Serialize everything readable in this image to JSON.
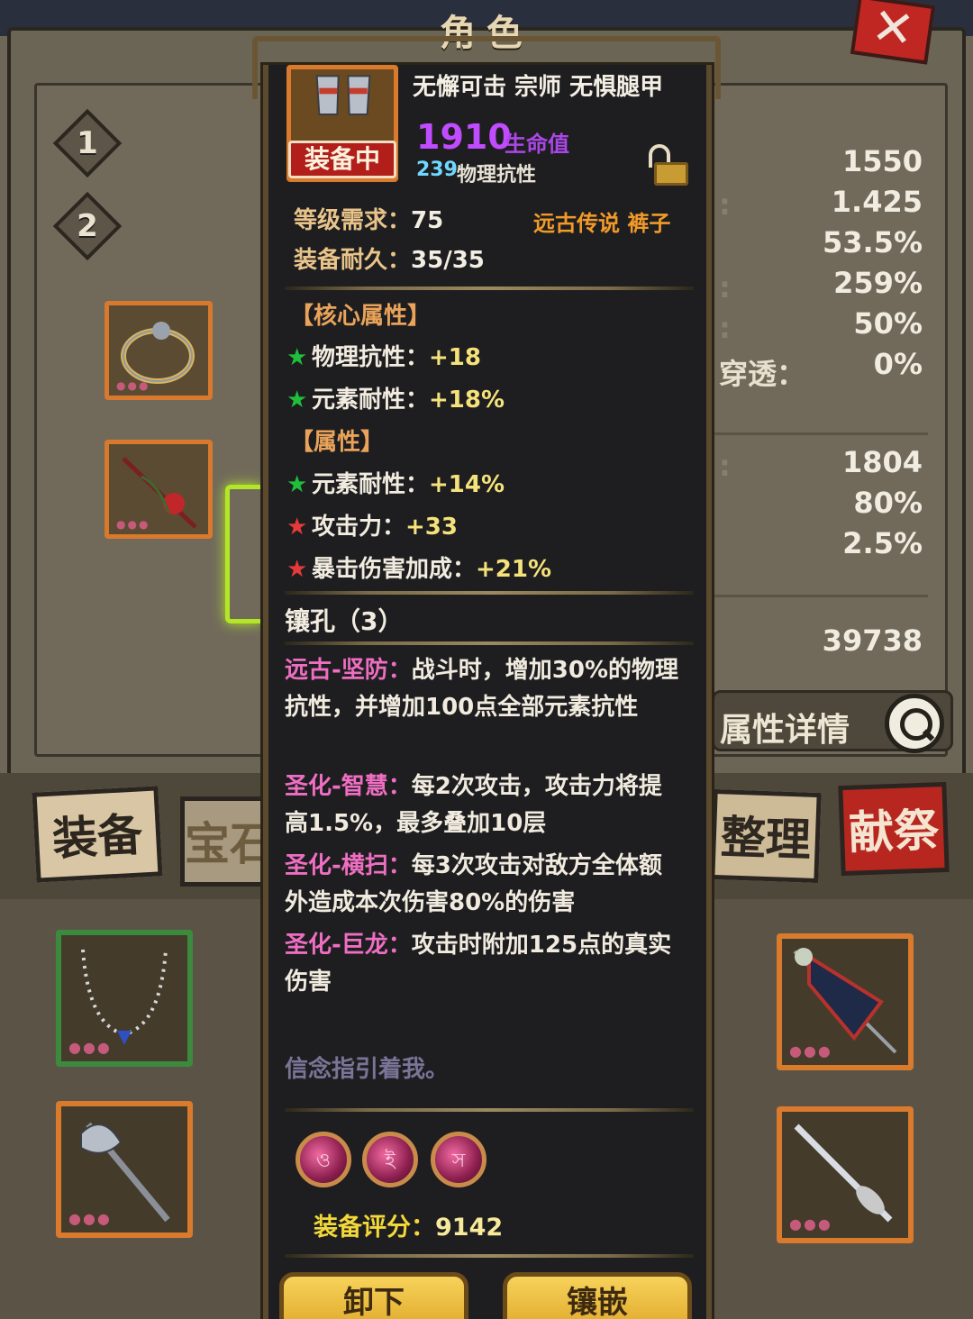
{
  "screen": {
    "title": "角色"
  },
  "left_panel": {
    "slot_tabs": [
      "1",
      "2"
    ]
  },
  "stats_panel": {
    "values": [
      "1550",
      "1.425",
      "53.5%",
      "259%",
      "50%",
      "0%",
      "1804",
      "80%",
      "2.5%",
      "39738"
    ],
    "visible_partial_label": "穿透：",
    "details_label": "属性详情"
  },
  "tabs": {
    "equip": "装备",
    "gem": "宝石",
    "sort": "整理",
    "sacrifice": "献祭"
  },
  "tooltip": {
    "item_name": "无懈可击 宗师 无惧腿甲",
    "equipped_badge": "装备中",
    "hp_value": "1910",
    "hp_label": "生命值",
    "phys_res_value": "239",
    "phys_res_label": "物理抗性",
    "level_req_label": "等级需求：",
    "level_req_value": "75",
    "durability_label": "装备耐久：",
    "durability_value": "35/35",
    "rarity": "远古传说 裤子",
    "core_header": "【核心属性】",
    "core_attrs": [
      {
        "star": "green",
        "name": "物理抗性：",
        "value": "+18"
      },
      {
        "star": "green",
        "name": "元素耐性：",
        "value": "+18%"
      }
    ],
    "attr_header": "【属性】",
    "attrs": [
      {
        "star": "green",
        "name": "元素耐性：",
        "value": "+14%"
      },
      {
        "star": "red",
        "name": "攻击力：",
        "value": "+33"
      },
      {
        "star": "red",
        "name": "暴击伤害加成：",
        "value": "+21%"
      }
    ],
    "socket_title": "镶孔（3）",
    "effects": [
      {
        "name": "远古-坚防：",
        "text": "战斗时，增加30%的物理抗性，并增加100点全部元素抗性"
      },
      {
        "name": "圣化-智慧：",
        "text": "每2次攻击，攻击力将提高1.5%，最多叠加10层"
      },
      {
        "name": "圣化-横扫：",
        "text": "每3次攻击对敌方全体额外造成本次伤害80%的伤害"
      },
      {
        "name": "圣化-巨龙：",
        "text": "攻击时附加125点的真实伤害"
      }
    ],
    "flavor": "信念指引着我。",
    "gem_icons": [
      "gem-icon",
      "gem-icon",
      "gem-icon"
    ],
    "score_label": "装备评分：",
    "score_value": "9142",
    "buttons": {
      "unequip": "卸下",
      "inlay": "镶嵌"
    }
  },
  "colors": {
    "hp": "#c04bff",
    "phys_res": "#6fd8ff",
    "rarity": "#f19a2a",
    "effect_name": "#ee6ec2",
    "attr_value": "#f5e27a",
    "equipped_badge": "#b21f1a"
  }
}
